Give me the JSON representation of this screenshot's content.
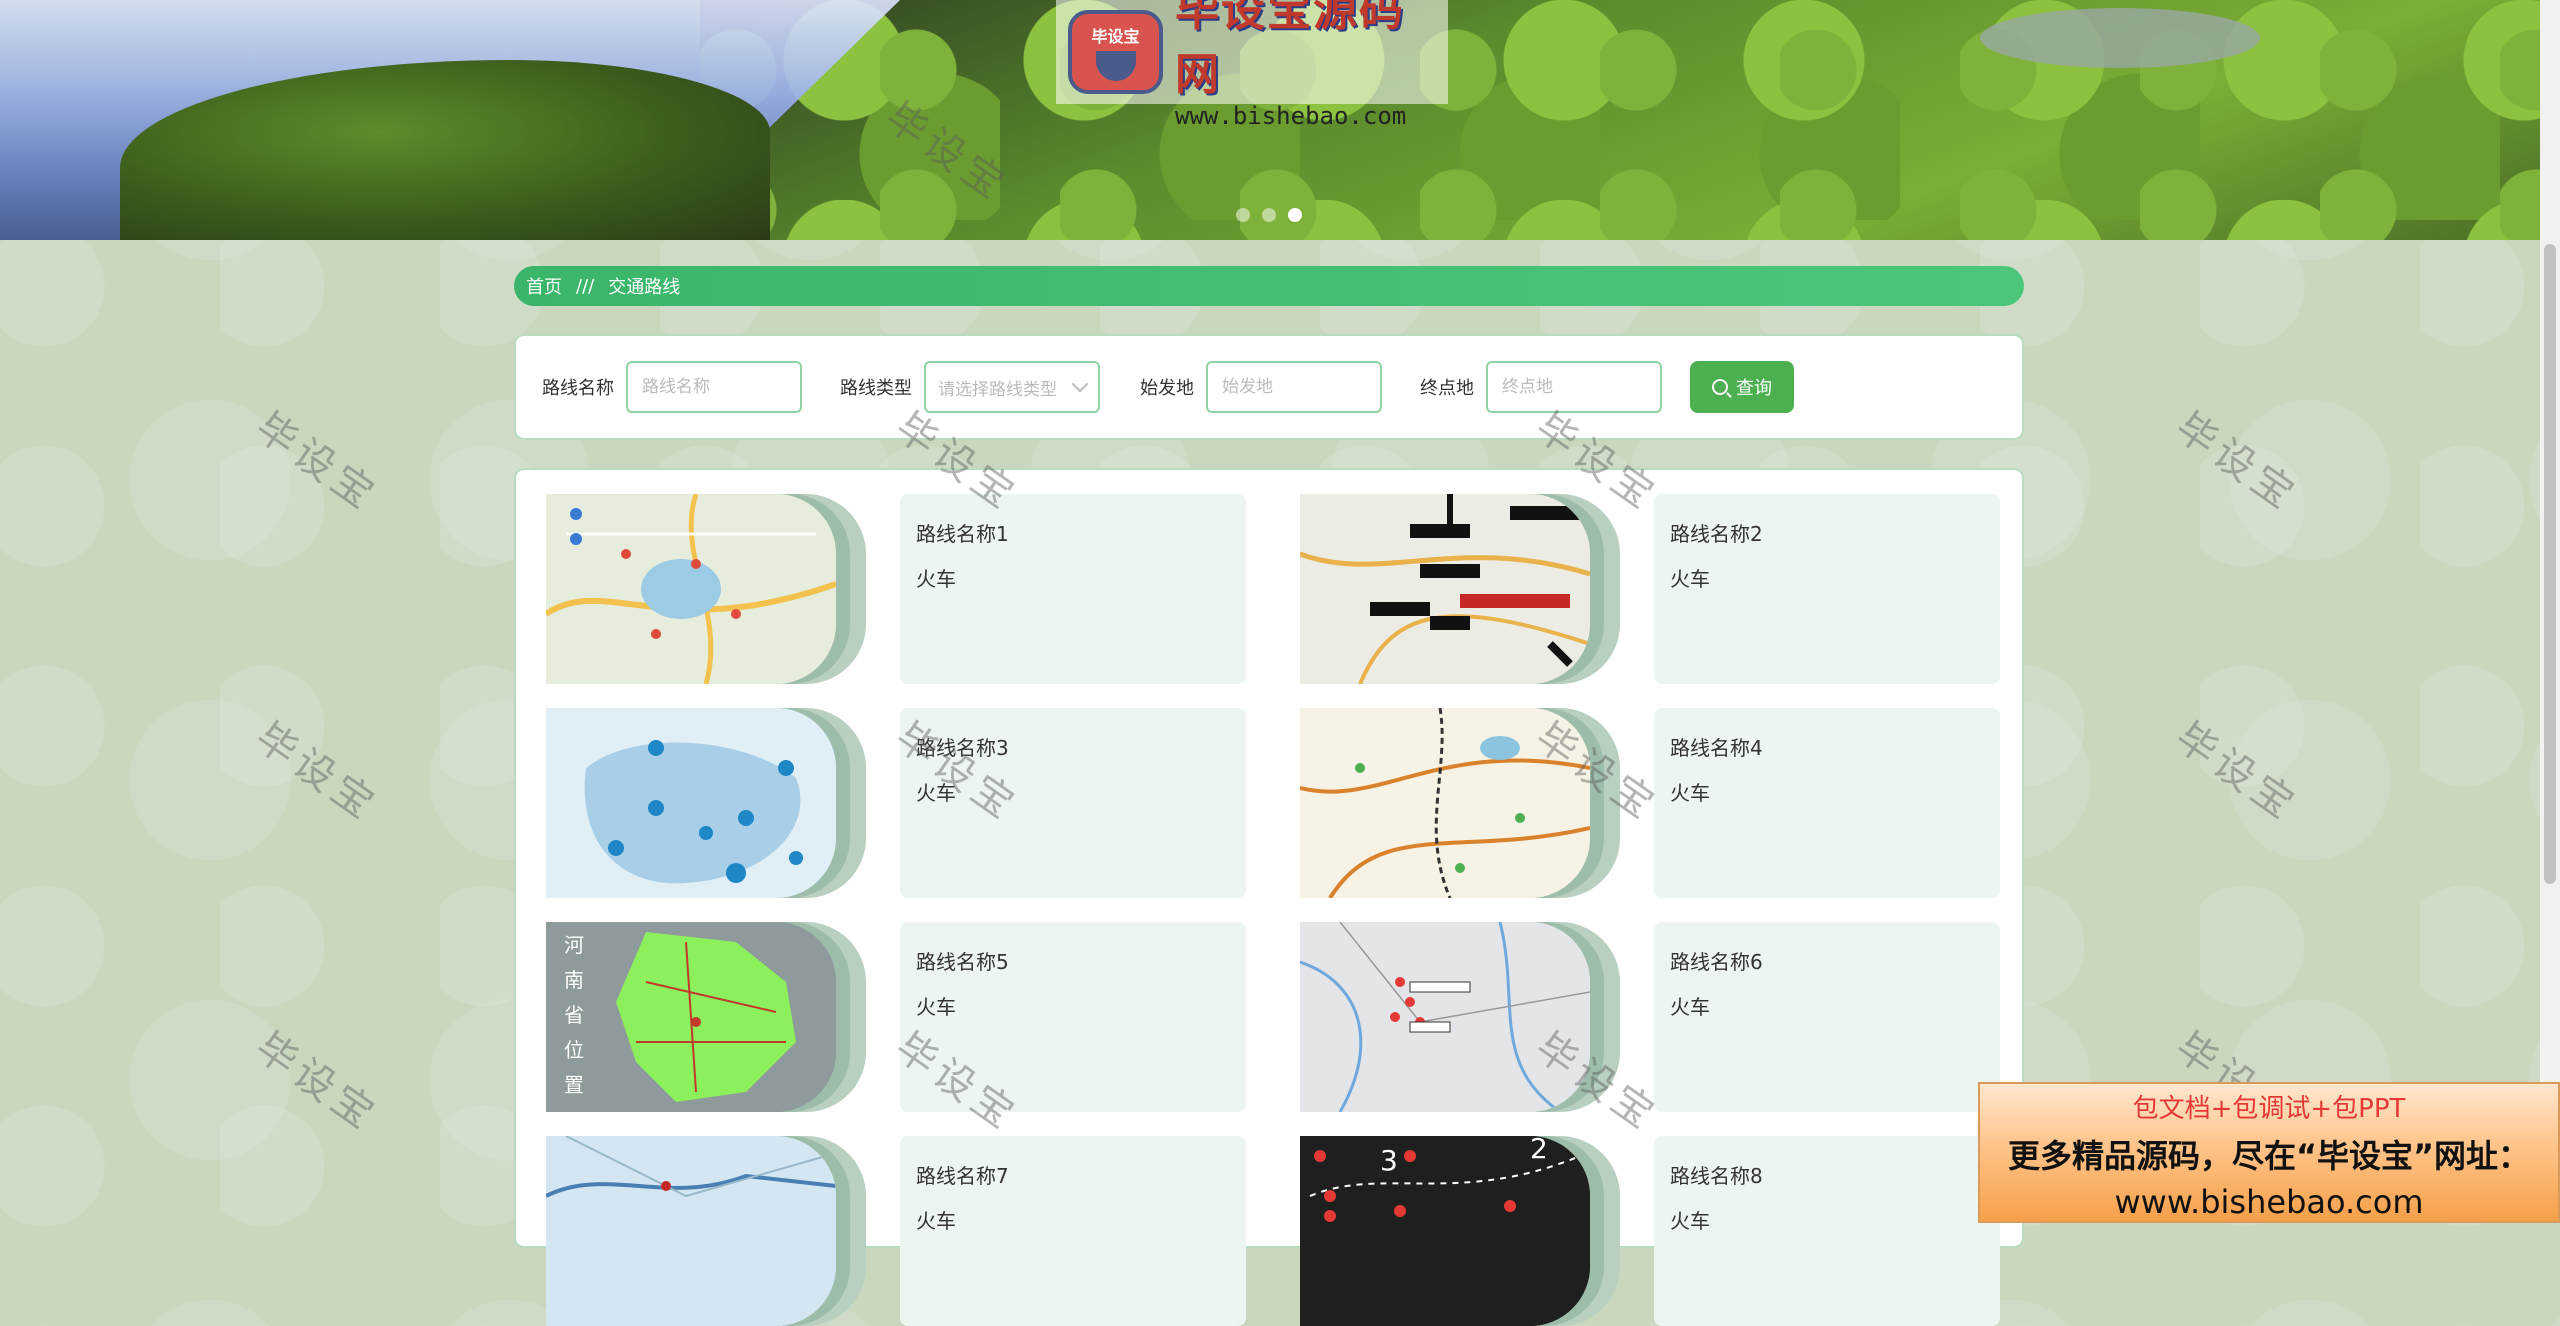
{
  "banner": {
    "logo_badge": "毕设宝",
    "logo_title": "毕设宝源码网",
    "logo_url": "www.bishebao.com",
    "slides": 3,
    "active_slide": 3
  },
  "breadcrumb": {
    "home": "首页",
    "separator": "///",
    "current": "交通路线"
  },
  "search": {
    "name_label": "路线名称",
    "name_placeholder": "路线名称",
    "type_label": "路线类型",
    "type_placeholder": "请选择路线类型",
    "start_label": "始发地",
    "start_placeholder": "始发地",
    "end_label": "终点地",
    "end_placeholder": "终点地",
    "query_label": "查询"
  },
  "routes": [
    {
      "name": "路线名称1",
      "type": "火车"
    },
    {
      "name": "路线名称2",
      "type": "火车"
    },
    {
      "name": "路线名称3",
      "type": "火车"
    },
    {
      "name": "路线名称4",
      "type": "火车"
    },
    {
      "name": "路线名称5",
      "type": "火车"
    },
    {
      "name": "路线名称6",
      "type": "火车"
    },
    {
      "name": "路线名称7",
      "type": "火车"
    },
    {
      "name": "路线名称8",
      "type": "火车"
    }
  ],
  "watermark_text": "毕设宝",
  "ad": {
    "line1": "包文档+包调试+包PPT",
    "line2": "更多精品源码，尽在“毕设宝”网址：",
    "line3": "www.bishebao.com"
  },
  "colors": {
    "accent": "#4caf50",
    "breadcrumb": "#3bb56a",
    "page_bg": "#c9d7bf",
    "card_bg": "#ecf5f0"
  }
}
